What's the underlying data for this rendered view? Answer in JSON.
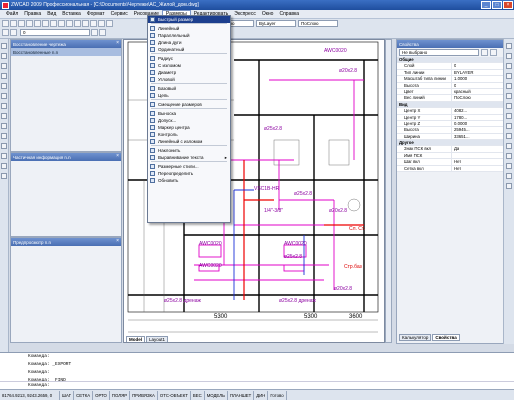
{
  "title": "ZWCAD 2009 Профессиональная - [C:\\Documents\\Чертежи\\АС_Жилой_дом.dwg]",
  "menubar": [
    "Файл",
    "Правка",
    "Вид",
    "Вставка",
    "Формат",
    "Сервис",
    "Рисование",
    "Размеры",
    "Редактировать",
    "Экспресс",
    "Окно",
    "Справка"
  ],
  "toolbar": {
    "layer": "0",
    "linetype": "ByLayer",
    "lineweight": "ПоСлою",
    "color": "ПоСлою"
  },
  "left_panels": [
    {
      "title": "Восстановление чертежа",
      "sub": "Восстановленные n.n"
    },
    {
      "title": "Частичная информация n.n"
    },
    {
      "title": "Предпросмотр n.n"
    }
  ],
  "dim_menu": [
    {
      "label": "Быстрый размер"
    },
    {
      "sep": true
    },
    {
      "label": "Линейный"
    },
    {
      "label": "Параллельный"
    },
    {
      "label": "Длина дуги"
    },
    {
      "label": "Ординатный"
    },
    {
      "sep": true
    },
    {
      "label": "Радиус"
    },
    {
      "label": "С изломом"
    },
    {
      "label": "Диаметр"
    },
    {
      "label": "Угловой"
    },
    {
      "sep": true
    },
    {
      "label": "Базовый"
    },
    {
      "label": "Цепь"
    },
    {
      "sep": true
    },
    {
      "label": "Смещение размеров"
    },
    {
      "sep": true
    },
    {
      "label": "Выноска"
    },
    {
      "label": "Допуск..."
    },
    {
      "label": "Маркер центра"
    },
    {
      "label": "Контроль"
    },
    {
      "label": "Линейный с изломом"
    },
    {
      "sep": true
    },
    {
      "label": "Наклонить"
    },
    {
      "label": "Выравнивание текста",
      "sub": true
    },
    {
      "sep": true
    },
    {
      "label": "Размерные стили..."
    },
    {
      "label": "Переопределить"
    },
    {
      "label": "Обновить"
    }
  ],
  "props": {
    "title": "Свойства",
    "selection": "Не выбрано",
    "rows": [
      {
        "cat": "Общие"
      },
      {
        "k": "Слой",
        "v": "0"
      },
      {
        "k": "Тип линии",
        "v": "BYLAYER"
      },
      {
        "k": "Масштаб типа линии",
        "v": "1.0000"
      },
      {
        "k": "Высота",
        "v": "0"
      },
      {
        "k": "Цвет",
        "v": "красный"
      },
      {
        "k": "Вес линий",
        "v": "ПоСлою"
      },
      {
        "cat": "Вид"
      },
      {
        "k": "Центр X",
        "v": "4082..."
      },
      {
        "k": "Центр Y",
        "v": "1780..."
      },
      {
        "k": "Центр Z",
        "v": "0.0000"
      },
      {
        "k": "Высота",
        "v": "25945..."
      },
      {
        "k": "Ширина",
        "v": "33651..."
      },
      {
        "cat": "Другое"
      },
      {
        "k": "Знак ПСК вкл",
        "v": "Да"
      },
      {
        "k": "Имя ПСК",
        "v": ""
      },
      {
        "k": "Шаг вкл",
        "v": "Нет"
      },
      {
        "k": "Сетка вкл",
        "v": "Нет"
      }
    ],
    "tabs": [
      "Калькулятор",
      "Свойства"
    ]
  },
  "drawing": {
    "tabs": [
      "Model",
      "Layout1"
    ],
    "texts": [
      "AWC0020",
      "ø20x2.8",
      "ø25x2.8",
      "ø25x2.8",
      "VSC1B-HR",
      "1/4\"-3/8\"",
      "AWC0020",
      "AWC0020",
      "AWC0020",
      "ø20x2.8",
      "ø25x2.8",
      "ø25x2.8 дренаж",
      "ø25x2.8 дренаж",
      "5300",
      "5300",
      "3600",
      "ø20x2.8",
      "Сл. Ст.",
      "Стр.баз"
    ]
  },
  "commands": [
    "Команда:",
    "Команда: _EXPORT",
    "Команда:",
    "Команда: _FIND",
    "Команда:"
  ],
  "status": {
    "coords": "81764.9213, 9243.2659, 0",
    "buttons": [
      "ШАГ",
      "СЕТКА",
      "ОРТО",
      "ПОЛЯР",
      "ПРИВЯЗКА",
      "ОТС-ОБЪЕКТ",
      "ВЕС",
      "МОДЕЛЬ",
      "ПЛАНШЕТ",
      "ДИН",
      "Готово"
    ]
  }
}
